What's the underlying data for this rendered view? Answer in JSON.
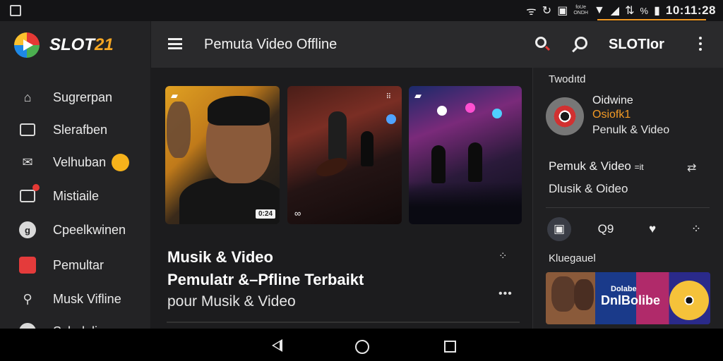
{
  "status_bar": {
    "mini_text": [
      "foUe",
      "ONDH"
    ],
    "battery_percent": "%",
    "time": "10:11:28",
    "accent": "#f39a25"
  },
  "sidebar": {
    "logo_text": "SLOT",
    "logo_number": "21",
    "items": [
      {
        "label": "Sugrerpan",
        "icon": "home-icon"
      },
      {
        "label": "Slerafben",
        "icon": "mail-icon"
      },
      {
        "label": "Velhuban",
        "icon": "envelope-icon"
      },
      {
        "label": "Mistiaile",
        "icon": "video-icon"
      },
      {
        "label": "Cpeelkwinen",
        "icon": "circle-icon"
      },
      {
        "label": "Pemultar",
        "icon": "red-app-icon"
      },
      {
        "label": "Musk Vifline",
        "icon": "pin-icon"
      },
      {
        "label": "Schulalis",
        "icon": "circle-icon"
      }
    ]
  },
  "appbar": {
    "title": "Pemuta Video Offline",
    "user_label": "SLOTIor"
  },
  "main": {
    "thumb1_chip": "0:24",
    "card_title": "Musik & Video",
    "card_subtitle": "Pemulatr &–Pfline Terbaikt",
    "card_subtitle2": "pour Musik & Video"
  },
  "right_panel": {
    "heading1": "Twodıtd",
    "row1_line1": "Oidwine",
    "row1_line2": "Osiofk1",
    "row1_line3": "Penulk & Video",
    "row2_line1": "Pemuk & Video",
    "row2_suffix": "=it",
    "row2_line2": "Dlusik & Oideo",
    "actions_label": "Q9",
    "heading2": "Kluegauel",
    "banner_line1": "Dolabe",
    "banner_line2": "DnlBolibe"
  }
}
